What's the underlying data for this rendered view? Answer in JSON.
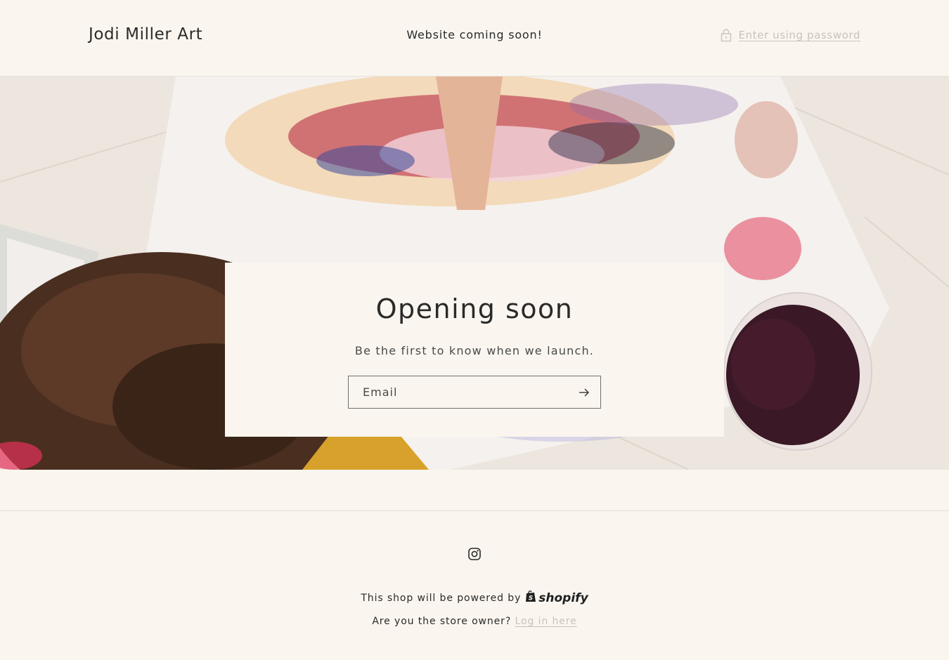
{
  "header": {
    "store_name": "Jodi Miller Art",
    "announcement": "Website coming soon!",
    "password_link": "Enter using password",
    "password_icon": "lock-icon"
  },
  "signup": {
    "title": "Opening soon",
    "subtitle": "Be the first to know when we launch.",
    "email_placeholder": "Email",
    "submit_icon": "arrow-right-icon"
  },
  "footer": {
    "social_icon": "instagram-icon",
    "powered_by": "This shop will be powered by",
    "shopify_brand": "shopify",
    "owner_question": "Are you the store owner?",
    "login_link": "Log in here"
  },
  "colors": {
    "background": "#faf6ef",
    "text": "#2a2a2a",
    "muted_link": "#c9c3b9"
  }
}
